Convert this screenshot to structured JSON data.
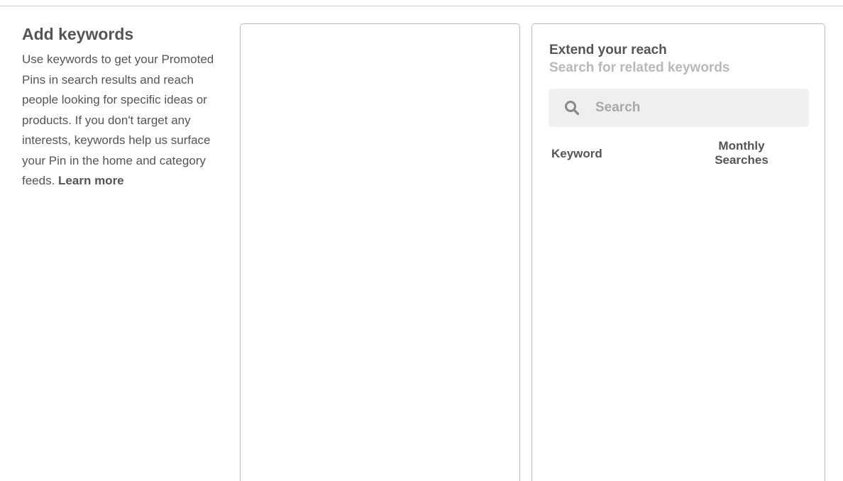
{
  "intro": {
    "title": "Add keywords",
    "body": "Use keywords to get your Promoted Pins in search results and reach people looking for specific ideas or products. If you don't target any interests, keywords help us surface your Pin in the home and category feeds. ",
    "link_label": "Learn more"
  },
  "reach": {
    "title": "Extend your reach",
    "subtitle": "Search for related keywords",
    "search": {
      "placeholder": "Search",
      "value": "",
      "icon": "search-icon"
    },
    "table": {
      "columns": [
        "Keyword",
        "Monthly Searches"
      ]
    }
  },
  "colors": {
    "text": "#555555",
    "muted": "#b8b8b8",
    "search_bg": "#efefef",
    "border": "#bdbdbd"
  }
}
